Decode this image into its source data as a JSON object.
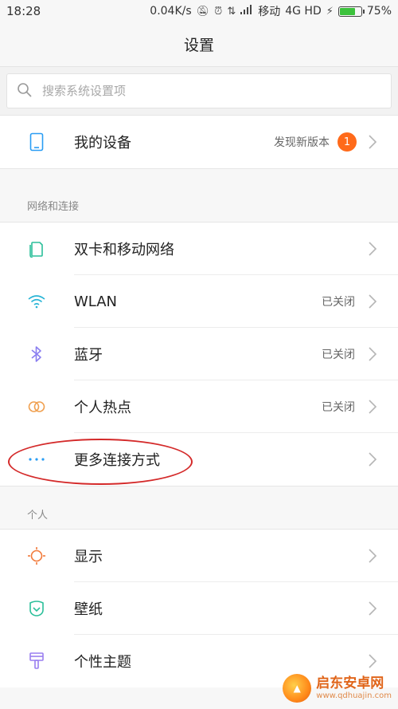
{
  "status_bar": {
    "time": "18:28",
    "speed": "0.04K/s",
    "carrier": "移动",
    "network": "4G HD",
    "battery": "75%",
    "battery_level": 0.75
  },
  "header": {
    "title": "设置"
  },
  "search": {
    "placeholder": "搜索系统设置项"
  },
  "device": {
    "label": "我的设备",
    "value": "发现新版本",
    "badge": "1"
  },
  "sections": {
    "network": {
      "title": "网络和连接",
      "items": [
        {
          "label": "双卡和移动网络",
          "value": "",
          "icon": "sim-card-icon"
        },
        {
          "label": "WLAN",
          "value": "已关闭",
          "icon": "wifi-icon"
        },
        {
          "label": "蓝牙",
          "value": "已关闭",
          "icon": "bluetooth-icon"
        },
        {
          "label": "个人热点",
          "value": "已关闭",
          "icon": "hotspot-icon"
        },
        {
          "label": "更多连接方式",
          "value": "",
          "icon": "more-dots-icon"
        }
      ]
    },
    "personal": {
      "title": "个人",
      "items": [
        {
          "label": "显示",
          "icon": "display-sun-icon"
        },
        {
          "label": "壁纸",
          "icon": "wallpaper-icon"
        },
        {
          "label": "个性主题",
          "icon": "theme-brush-icon"
        }
      ]
    }
  },
  "watermark": {
    "title": "启东安卓网",
    "url": "www.qdhuajin.com"
  },
  "colors": {
    "accent": "#ff6a1a",
    "annotation": "#d42a2a"
  }
}
